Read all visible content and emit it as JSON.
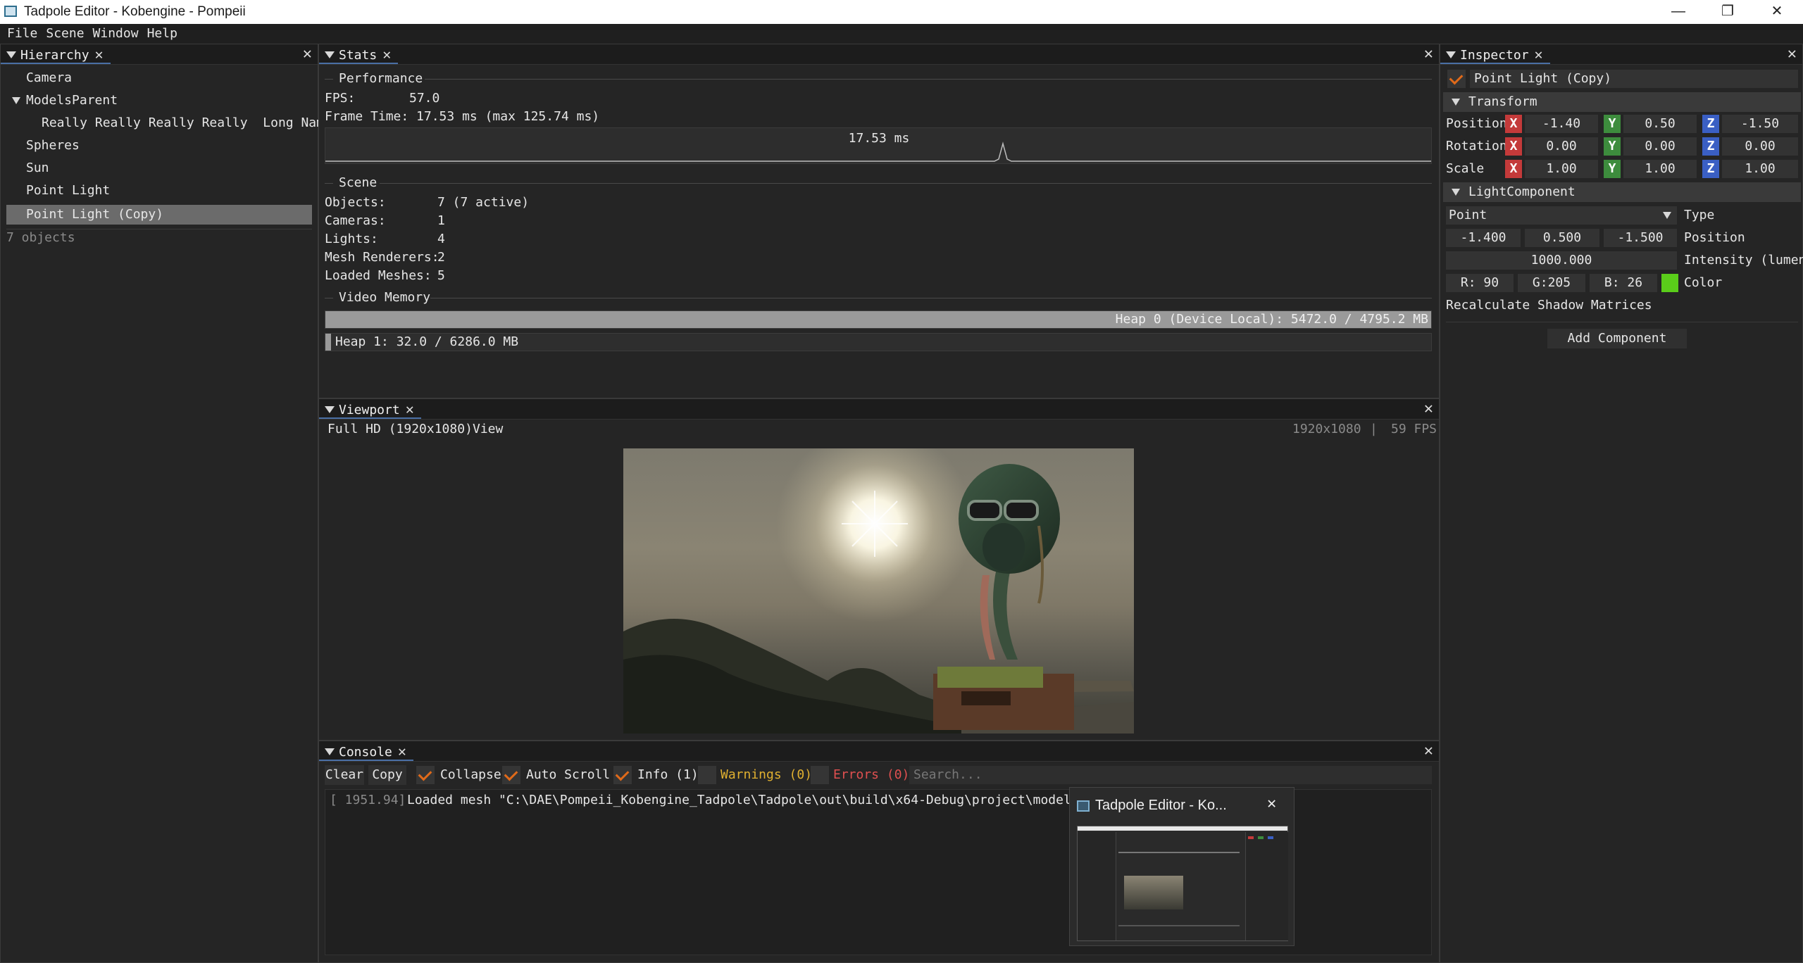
{
  "window": {
    "title": "Tadpole Editor - Kobengine - Pompeii",
    "minimize": "—",
    "maximize": "❐",
    "close": "✕"
  },
  "menu": [
    "File",
    "Scene",
    "Window",
    "Help"
  ],
  "hierarchy": {
    "tab": "Hierarchy",
    "items": [
      "Camera",
      "ModelsParent",
      "Really Really Really Really  Long Name",
      "Spheres",
      "Sun",
      "Point Light",
      "Point Light (Copy)"
    ],
    "footer": "7 objects"
  },
  "stats": {
    "tab": "Stats",
    "performance_label": "Performance",
    "fps_label": "FPS:",
    "fps_value": "57.0",
    "frame_time": "Frame Time: 17.53 ms (max 125.74 ms)",
    "graph_label": "17.53 ms",
    "scene_label": "Scene",
    "scene_rows": [
      {
        "label": "Objects:",
        "value": "7 (7 active)"
      },
      {
        "label": "Cameras:",
        "value": "1"
      },
      {
        "label": "Lights:",
        "value": "4"
      },
      {
        "label": "Mesh Renderers:",
        "value": "2"
      },
      {
        "label": "Loaded Meshes:",
        "value": "5"
      }
    ],
    "video_memory_label": "Video Memory",
    "heap0": "Heap 0 (Device Local): 5472.0 / 4795.2 MB",
    "heap0_fraction": 1.0,
    "heap1": "Heap 1: 32.0 / 6286.0 MB",
    "heap1_fraction": 0.005
  },
  "viewport": {
    "tab": "Viewport",
    "resolution": "Full HD (1920x1080)",
    "view": "View",
    "info_res": "1920x1080",
    "info_sep": "|",
    "info_fps": "59 FPS"
  },
  "console": {
    "tab": "Console",
    "clear": "Clear",
    "copy": "Copy",
    "collapse": "Collapse",
    "auto_scroll": "Auto Scroll",
    "info": "Info (1)",
    "warnings": "Warnings (0)",
    "errors": "Errors (0)",
    "search_placeholder": "Search...",
    "log_time": "[ 1951.94]",
    "log_msg": "Loaded mesh \"C:\\DAE\\Pompeii_Kobengine_Tadpole\\Tadpole\\out\\build\\x64-Debug\\project\\models\\Fligh"
  },
  "taskbar_preview": {
    "title": "Tadpole Editor - Ko...",
    "close": "✕"
  },
  "inspector": {
    "tab": "Inspector",
    "object_name": "Point Light (Copy)",
    "transform_label": "Transform",
    "position_label": "Position",
    "position": [
      "-1.40",
      "0.50",
      "-1.50"
    ],
    "rotation_label": "Rotation",
    "rotation": [
      "0.00",
      "0.00",
      "0.00"
    ],
    "scale_label": "Scale",
    "scale": [
      "1.00",
      "1.00",
      "1.00"
    ],
    "axes": [
      "X",
      "Y",
      "Z"
    ],
    "light_component_label": "LightComponent",
    "type_value": "Point",
    "type_label": "Type",
    "light_position": [
      "-1.400",
      "0.500",
      "-1.500"
    ],
    "light_position_label": "Position",
    "intensity_value": "1000.000",
    "intensity_label": "Intensity (lumen)",
    "color_r": "R: 90",
    "color_g": "G:205",
    "color_b": "B: 26",
    "color_label": "Color",
    "color_swatch": "#5acd1a",
    "recalc": "Recalculate Shadow Matrices",
    "add_component": "Add Component"
  }
}
